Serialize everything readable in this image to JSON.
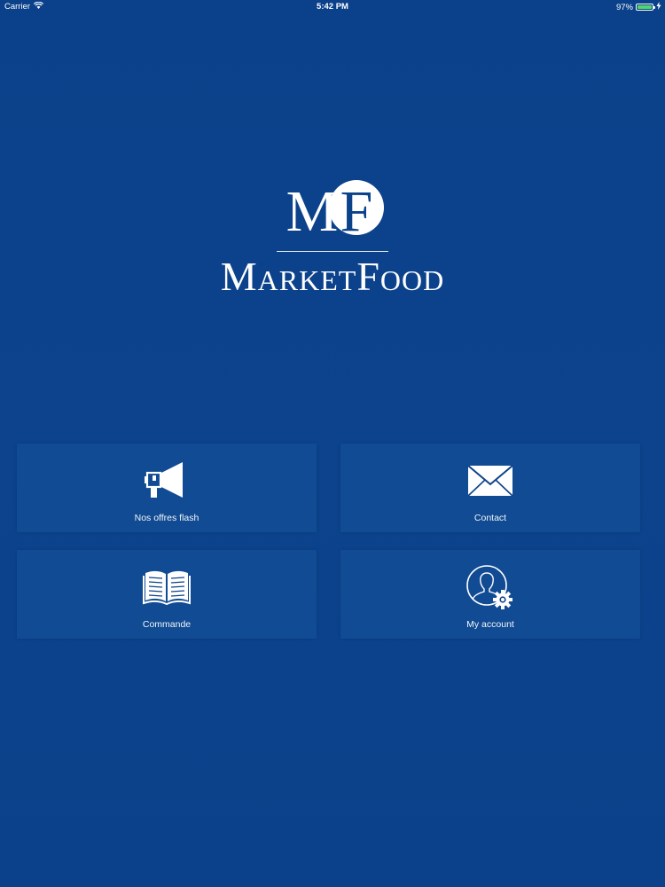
{
  "status_bar": {
    "carrier": "Carrier",
    "time": "5:42 PM",
    "battery_percent": "97%",
    "battery_level": 0.97
  },
  "logo": {
    "monogram": "MF",
    "wordmark": "MarketFood"
  },
  "menu": {
    "items": [
      {
        "label": "Nos offres flash",
        "icon": "megaphone-icon"
      },
      {
        "label": "Contact",
        "icon": "envelope-icon"
      },
      {
        "label": "Commande",
        "icon": "open-book-icon"
      },
      {
        "label": "My account",
        "icon": "user-settings-icon"
      }
    ]
  },
  "colors": {
    "background": "#0c428a",
    "tile": "#104b93",
    "text": "#ffffff",
    "battery": "#4cd964"
  }
}
